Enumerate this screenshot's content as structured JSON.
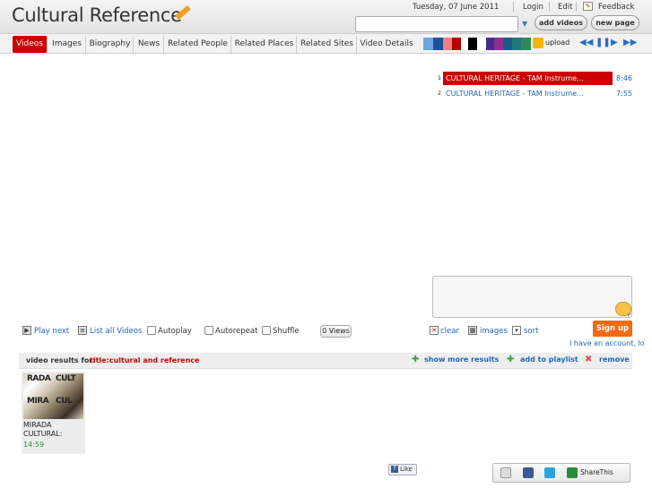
{
  "header": {
    "site_title": "Cultural Reference",
    "date": "Tuesday, 07 June 2011",
    "links": {
      "login": "Login",
      "edit": "Edit",
      "feedback": "Feedback"
    },
    "search": {
      "placeholder": ""
    },
    "buttons": {
      "add_videos": "add videos",
      "new_page": "new page"
    }
  },
  "tabs": [
    {
      "label": "Videos",
      "active": true
    },
    {
      "label": "Images"
    },
    {
      "label": "Biography"
    },
    {
      "label": "News"
    },
    {
      "label": "Related People"
    },
    {
      "label": "Related Places"
    },
    {
      "label": "Related Sites"
    },
    {
      "label": "Video Details"
    }
  ],
  "toolbar": {
    "swatch_colors": [
      "#6aa6e0",
      "#1f4e9a",
      "#f08080",
      "#b50000",
      "#ffffff",
      "#000000",
      "#ffffff",
      "#4a2b8a",
      "#8e2e8e",
      "#1a5a8a",
      "#1f7a7a",
      "#2e8b57",
      "#000000"
    ],
    "upload_label": "upload",
    "accent_color": "#cc0000"
  },
  "playlist": [
    {
      "num": "1",
      "title": "CULTURAL HERITAGE - TAM Instrume...",
      "duration": "8:46",
      "active": true
    },
    {
      "num": "2",
      "title": "CULTURAL HERITAGE - TAM Instrume...",
      "duration": "7:55",
      "active": false
    }
  ],
  "player_options": {
    "play_next": "Play next",
    "list_all": "List all Videos",
    "autoplay": "Autoplay",
    "autorepeat": "Autorepeat",
    "shuffle": "Shuffle",
    "views": "0 Views"
  },
  "comment_tools": {
    "clear": "clear",
    "images": "images",
    "sort": "sort"
  },
  "account": {
    "signup": "Sign up",
    "have_account": "I have an account, lo"
  },
  "results": {
    "label": "video results for:",
    "query": "title:cultural and reference",
    "show_more": "show more results",
    "add_playlist": "add to playlist",
    "remove": "remove"
  },
  "video_cards": [
    {
      "title": "MIRADA CULTURAL:",
      "duration": "14:59",
      "thumb_text": [
        "RADA",
        "CULT",
        "MIRA",
        "CUL"
      ]
    }
  ],
  "social": {
    "like": "Like",
    "sharethis": "ShareThis"
  }
}
